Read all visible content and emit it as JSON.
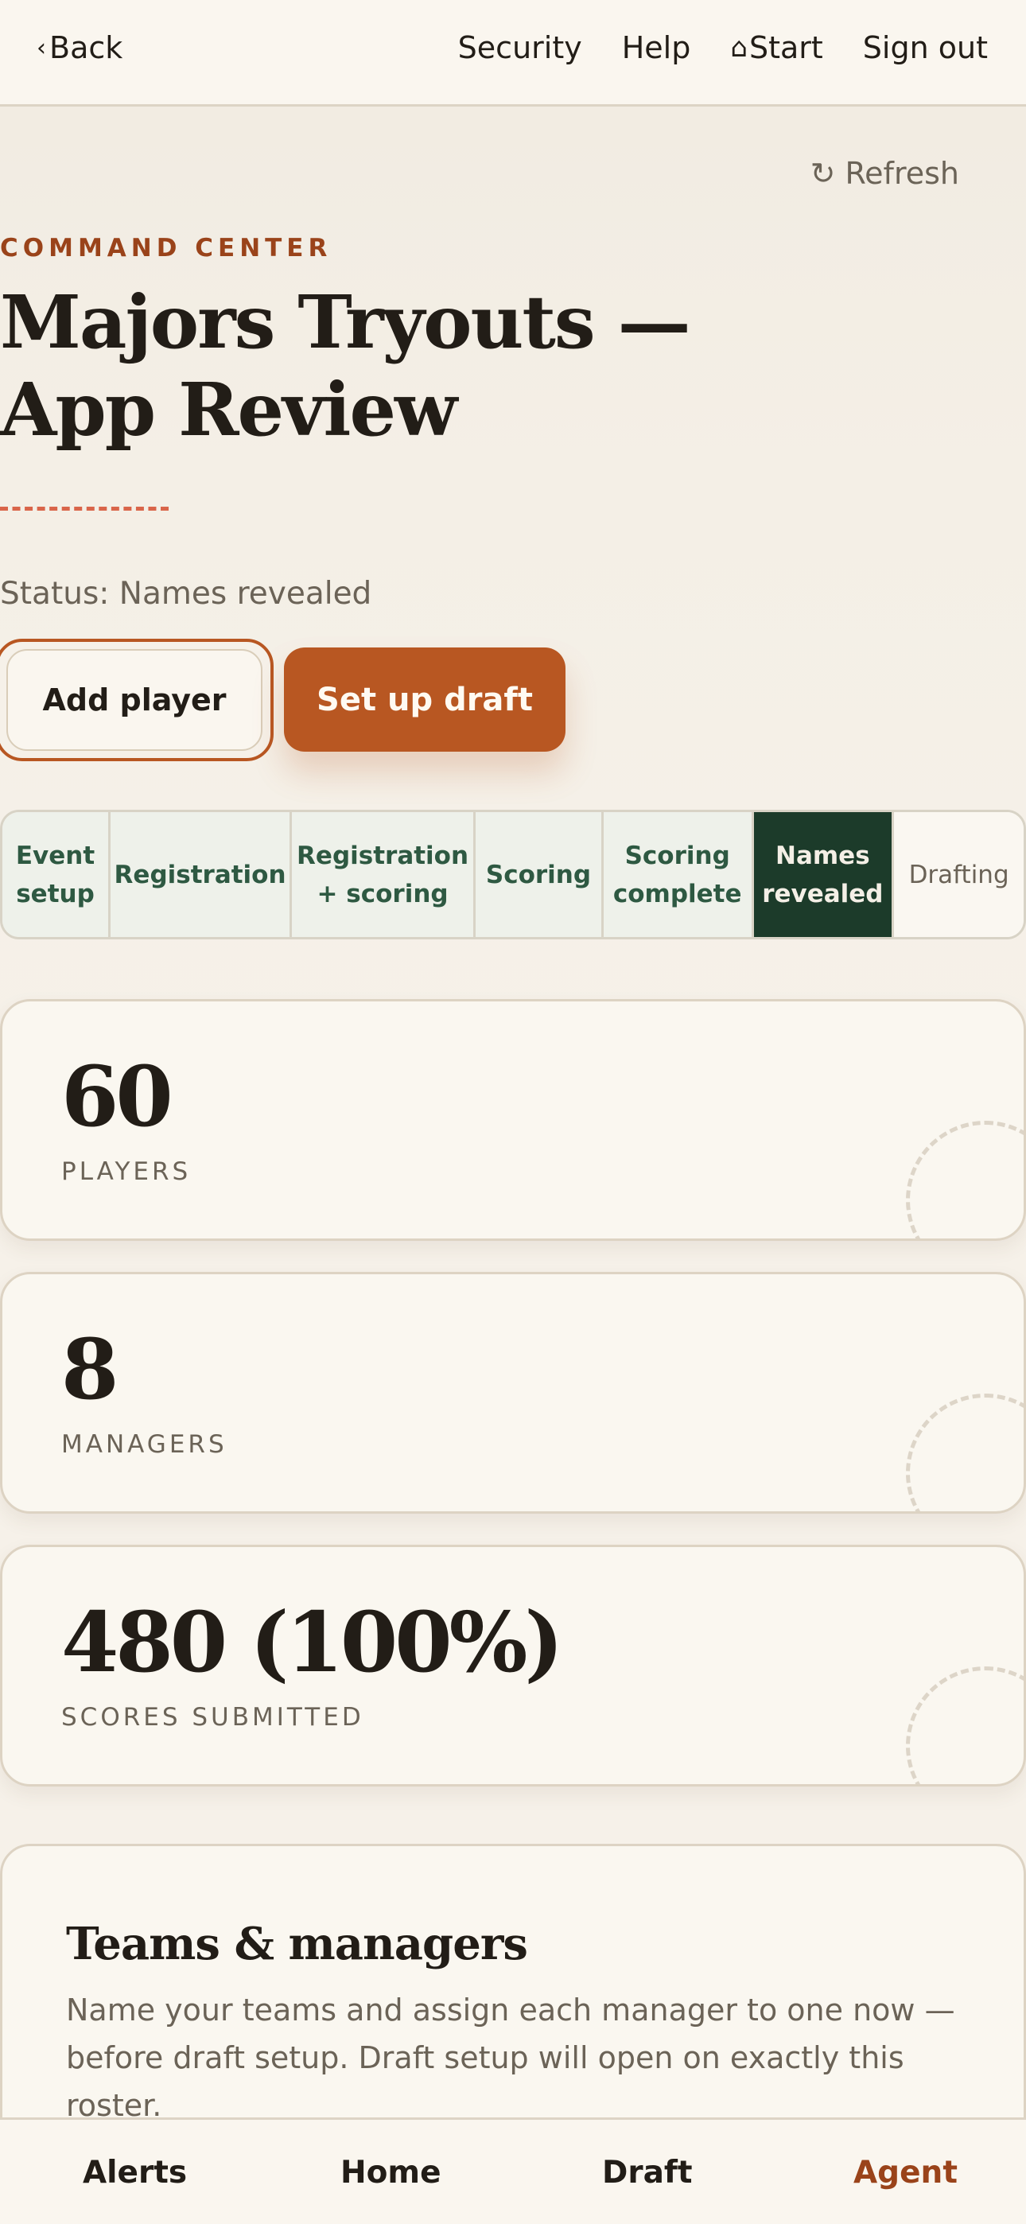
{
  "topnav": {
    "back_label": "Back",
    "links": [
      "Security",
      "Help",
      "Start",
      "Sign out"
    ]
  },
  "refresh_label": "Refresh",
  "eyebrow": "COMMAND CENTER",
  "title": "Majors Tryouts — App Review",
  "status": "Status: Names revealed",
  "actions": {
    "add_player": "Add player",
    "set_up_draft": "Set up draft"
  },
  "stepper": {
    "steps": [
      {
        "label": "Event setup",
        "state": "done"
      },
      {
        "label": "Registration",
        "state": "done"
      },
      {
        "label": "Registration + scoring",
        "state": "done"
      },
      {
        "label": "Scoring",
        "state": "done"
      },
      {
        "label": "Scoring complete",
        "state": "done"
      },
      {
        "label": "Names revealed",
        "state": "active"
      },
      {
        "label": "Drafting",
        "state": "todo"
      }
    ]
  },
  "stats": [
    {
      "value": "60",
      "label": "PLAYERS"
    },
    {
      "value": "8",
      "label": "MANAGERS"
    },
    {
      "value": "480 (100%)",
      "label": "SCORES SUBMITTED"
    }
  ],
  "teams": {
    "title": "Teams & managers",
    "description": "Name your teams and assign each manager to one now — before draft setup. Draft setup will open on exactly this roster."
  },
  "bottomnav": {
    "tabs": [
      "Alerts",
      "Home",
      "Draft",
      "Agent"
    ],
    "active": "Agent"
  },
  "colors": {
    "accent": "#b85722",
    "active_step": "#1c3b2a",
    "done_step": "#eef1ea"
  }
}
